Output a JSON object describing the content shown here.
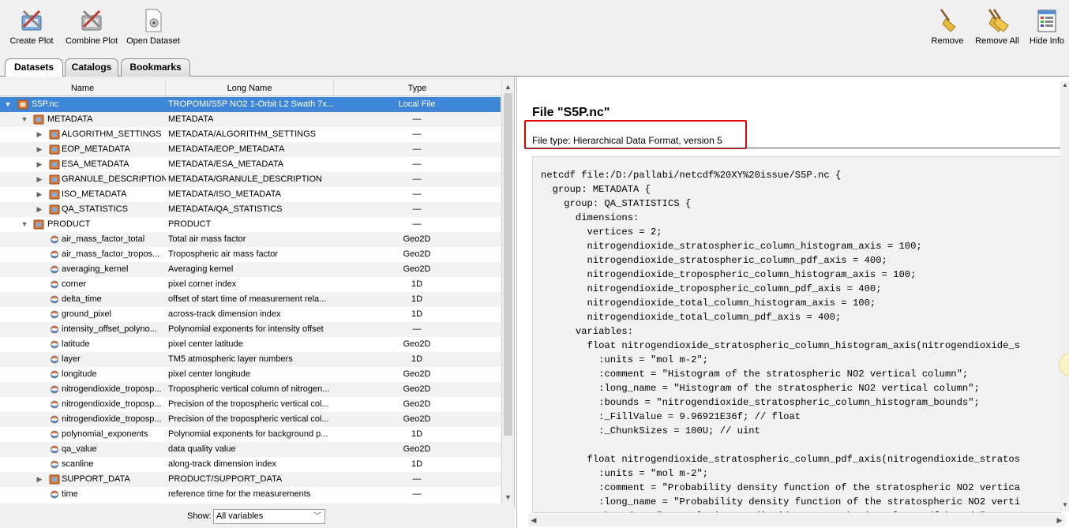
{
  "toolbar": {
    "left_buttons": [
      {
        "label": "Create Plot",
        "icon": "create-plot-icon"
      },
      {
        "label": "Combine Plot",
        "icon": "combine-plot-icon"
      },
      {
        "label": "Open Dataset",
        "icon": "open-dataset-icon"
      }
    ],
    "right_buttons": [
      {
        "label": "Remove",
        "icon": "broom-icon"
      },
      {
        "label": "Remove All",
        "icon": "broom-pair-icon"
      },
      {
        "label": "Hide Info",
        "icon": "hide-info-icon"
      }
    ]
  },
  "tabs": [
    {
      "label": "Datasets",
      "active": true
    },
    {
      "label": "Catalogs",
      "active": false
    },
    {
      "label": "Bookmarks",
      "active": false
    }
  ],
  "tree": {
    "columns": [
      "Name",
      "Long Name",
      "Type"
    ],
    "rows": [
      {
        "name": "S5P.nc",
        "long_name": "TROPOMI/S5P NO2 1-Orbit L2 Swath 7x...",
        "type": "Local File",
        "level": 0,
        "toggle": "▼",
        "icon": "file-icon"
      },
      {
        "name": "METADATA",
        "long_name": "METADATA",
        "type": "—",
        "level": 1,
        "toggle": "▼",
        "icon": "folder-icon"
      },
      {
        "name": "ALGORITHM_SETTINGS",
        "long_name": "METADATA/ALGORITHM_SETTINGS",
        "type": "—",
        "level": 2,
        "toggle": "▶",
        "icon": "folder-icon"
      },
      {
        "name": "EOP_METADATA",
        "long_name": "METADATA/EOP_METADATA",
        "type": "—",
        "level": 2,
        "toggle": "▶",
        "icon": "folder-icon"
      },
      {
        "name": "ESA_METADATA",
        "long_name": "METADATA/ESA_METADATA",
        "type": "—",
        "level": 2,
        "toggle": "▶",
        "icon": "folder-icon"
      },
      {
        "name": "GRANULE_DESCRIPTION",
        "long_name": "METADATA/GRANULE_DESCRIPTION",
        "type": "—",
        "level": 2,
        "toggle": "▶",
        "icon": "folder-icon"
      },
      {
        "name": "ISO_METADATA",
        "long_name": "METADATA/ISO_METADATA",
        "type": "—",
        "level": 2,
        "toggle": "▶",
        "icon": "folder-icon"
      },
      {
        "name": "QA_STATISTICS",
        "long_name": "METADATA/QA_STATISTICS",
        "type": "—",
        "level": 2,
        "toggle": "▶",
        "icon": "folder-icon"
      },
      {
        "name": "PRODUCT",
        "long_name": "PRODUCT",
        "type": "—",
        "level": 1,
        "toggle": "▼",
        "icon": "folder-icon"
      },
      {
        "name": "air_mass_factor_total",
        "long_name": "Total air mass factor",
        "type": "Geo2D",
        "level": 2,
        "toggle": "",
        "icon": "variable-icon"
      },
      {
        "name": "air_mass_factor_tropos...",
        "long_name": "Tropospheric air mass factor",
        "type": "Geo2D",
        "level": 2,
        "toggle": "",
        "icon": "variable-icon"
      },
      {
        "name": "averaging_kernel",
        "long_name": "Averaging kernel",
        "type": "Geo2D",
        "level": 2,
        "toggle": "",
        "icon": "variable-icon"
      },
      {
        "name": "corner",
        "long_name": "pixel corner index",
        "type": "1D",
        "level": 2,
        "toggle": "",
        "icon": "variable-icon"
      },
      {
        "name": "delta_time",
        "long_name": "offset of start time of measurement rela...",
        "type": "1D",
        "level": 2,
        "toggle": "",
        "icon": "variable-icon"
      },
      {
        "name": "ground_pixel",
        "long_name": "across-track dimension index",
        "type": "1D",
        "level": 2,
        "toggle": "",
        "icon": "variable-icon"
      },
      {
        "name": "intensity_offset_polyno...",
        "long_name": "Polynomial exponents for intensity offset",
        "type": "—",
        "level": 2,
        "toggle": "",
        "icon": "variable-icon"
      },
      {
        "name": "latitude",
        "long_name": "pixel center latitude",
        "type": "Geo2D",
        "level": 2,
        "toggle": "",
        "icon": "variable-icon"
      },
      {
        "name": "layer",
        "long_name": "TM5 atmospheric layer numbers",
        "type": "1D",
        "level": 2,
        "toggle": "",
        "icon": "variable-icon"
      },
      {
        "name": "longitude",
        "long_name": "pixel center longitude",
        "type": "Geo2D",
        "level": 2,
        "toggle": "",
        "icon": "variable-icon"
      },
      {
        "name": "nitrogendioxide_troposp...",
        "long_name": "Tropospheric vertical column of nitrogen...",
        "type": "Geo2D",
        "level": 2,
        "toggle": "",
        "icon": "variable-icon"
      },
      {
        "name": "nitrogendioxide_troposp...",
        "long_name": "Precision of the tropospheric vertical col...",
        "type": "Geo2D",
        "level": 2,
        "toggle": "",
        "icon": "variable-icon"
      },
      {
        "name": "nitrogendioxide_troposp...",
        "long_name": "Precision of the tropospheric vertical col...",
        "type": "Geo2D",
        "level": 2,
        "toggle": "",
        "icon": "variable-icon"
      },
      {
        "name": "polynomial_exponents",
        "long_name": "Polynomial exponents for background p...",
        "type": "1D",
        "level": 2,
        "toggle": "",
        "icon": "variable-icon"
      },
      {
        "name": "qa_value",
        "long_name": "data quality value",
        "type": "Geo2D",
        "level": 2,
        "toggle": "",
        "icon": "variable-icon"
      },
      {
        "name": "scanline",
        "long_name": "along-track dimension index",
        "type": "1D",
        "level": 2,
        "toggle": "",
        "icon": "variable-icon"
      },
      {
        "name": "SUPPORT_DATA",
        "long_name": "PRODUCT/SUPPORT_DATA",
        "type": "—",
        "level": 2,
        "toggle": "▶",
        "icon": "folder-icon"
      },
      {
        "name": "time",
        "long_name": "reference time for the measurements",
        "type": "—",
        "level": 2,
        "toggle": "",
        "icon": "variable-icon"
      }
    ]
  },
  "show": {
    "label": "Show:",
    "value": "All variables"
  },
  "info": {
    "title": "File \"S5P.nc\"",
    "file_type": "File type: Hierarchical Data Format, version 5",
    "cdl_lines": [
      "netcdf file:/D:/pallabi/netcdf%20XY%20issue/S5P.nc {",
      "  group: METADATA {",
      "    group: QA_STATISTICS {",
      "      dimensions:",
      "        vertices = 2;",
      "        nitrogendioxide_stratospheric_column_histogram_axis = 100;",
      "        nitrogendioxide_stratospheric_column_pdf_axis = 400;",
      "        nitrogendioxide_tropospheric_column_histogram_axis = 100;",
      "        nitrogendioxide_tropospheric_column_pdf_axis = 400;",
      "        nitrogendioxide_total_column_histogram_axis = 100;",
      "        nitrogendioxide_total_column_pdf_axis = 400;",
      "      variables:",
      "        float nitrogendioxide_stratospheric_column_histogram_axis(nitrogendioxide_s",
      "          :units = \"mol m-2\";",
      "          :comment = \"Histogram of the stratospheric NO2 vertical column\";",
      "          :long_name = \"Histogram of the stratospheric NO2 vertical column\";",
      "          :bounds = \"nitrogendioxide_stratospheric_column_histogram_bounds\";",
      "          :_FillValue = 9.96921E36f; // float",
      "          :_ChunkSizes = 100U; // uint",
      "",
      "        float nitrogendioxide_stratospheric_column_pdf_axis(nitrogendioxide_stratos",
      "          :units = \"mol m-2\";",
      "          :comment = \"Probability density function of the stratospheric NO2 vertica",
      "          :long_name = \"Probability density function of the stratospheric NO2 verti",
      "          :bounds = \"aerosol_nitrogendioxide_stratospheric_column_pdf_bounds\";"
    ]
  }
}
